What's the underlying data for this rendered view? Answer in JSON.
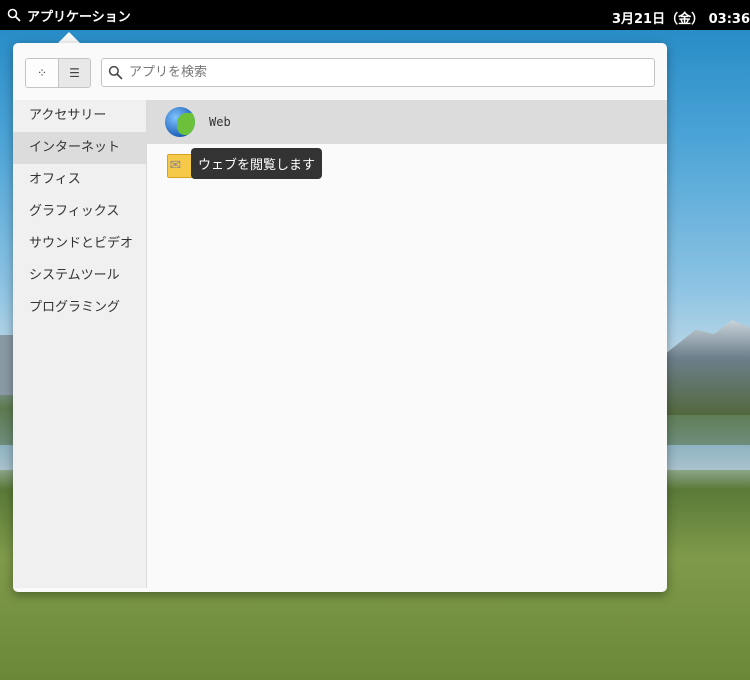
{
  "panel": {
    "apps_label": "アプリケーション",
    "clock": "3月21日（金） 03:36"
  },
  "menu": {
    "view_buttons": [
      {
        "name": "grid-view",
        "glyph": "⁘"
      },
      {
        "name": "category-view",
        "glyph": "☰"
      }
    ],
    "search": {
      "placeholder": "アプリを検索",
      "value": ""
    },
    "categories": [
      {
        "label": "アクセサリー"
      },
      {
        "label": "インターネット",
        "selected": true
      },
      {
        "label": "オフィス"
      },
      {
        "label": "グラフィックス"
      },
      {
        "label": "サウンドとビデオ"
      },
      {
        "label": "システムツール"
      },
      {
        "label": "プログラミング"
      }
    ],
    "apps": [
      {
        "label": "Web",
        "icon": "web-browser-icon"
      },
      {
        "label": "",
        "icon": "mail-icon"
      }
    ],
    "tooltip": "ウェブを閲覧します"
  }
}
